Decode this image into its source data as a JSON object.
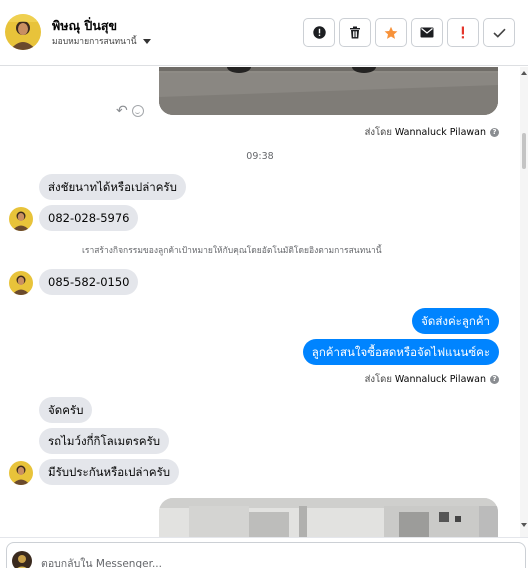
{
  "header": {
    "contact_name": "พิษณุ ปิ่นสุข",
    "assign_label": "มอบหมายการสนทนานี้",
    "tools": [
      {
        "name": "spam",
        "icon": "exclamation-circle-icon"
      },
      {
        "name": "delete",
        "icon": "trash-icon"
      },
      {
        "name": "star",
        "icon": "star-icon"
      },
      {
        "name": "mark-unread",
        "icon": "envelope-icon"
      },
      {
        "name": "follow-up",
        "icon": "exclamation-icon"
      },
      {
        "name": "done",
        "icon": "check-icon"
      }
    ]
  },
  "colors": {
    "accent": "#0084ff",
    "star": "#f7923a",
    "follow_up": "#e4362c",
    "incoming_bubble": "#e4e6eb"
  },
  "messages": {
    "sent_by_1_prefix": "ส่งโดย",
    "sent_by_1_name": "Wannaluck Pilawan",
    "time_label": "09:38",
    "in_1": "ส่งชัยนาทได้หรือเปล่าครับ",
    "in_2": "082-028-5976",
    "system_note": "เราสร้างกิจกรรมของลูกค้าเป้าหมายให้กับคุณโดยอัตโนมัติโดยอิงตามการสนทนานี้",
    "in_3": "085-582-0150",
    "out_1": "จัดส่งค่ะลูกค้า",
    "out_2": "ลูกค้าสนใจซื้อสดหรือจัดไฟแนนซ์คะ",
    "sent_by_2_prefix": "ส่งโดย",
    "sent_by_2_name": "Wannaluck Pilawan",
    "in_4": "จัดครับ",
    "in_5": "รถไมว์งกี่กิโลเมตรครับ",
    "in_6": "มีรับประกันหรือเปล่าครับ"
  },
  "composer": {
    "placeholder": "ตอบกลับใน Messenger..."
  }
}
